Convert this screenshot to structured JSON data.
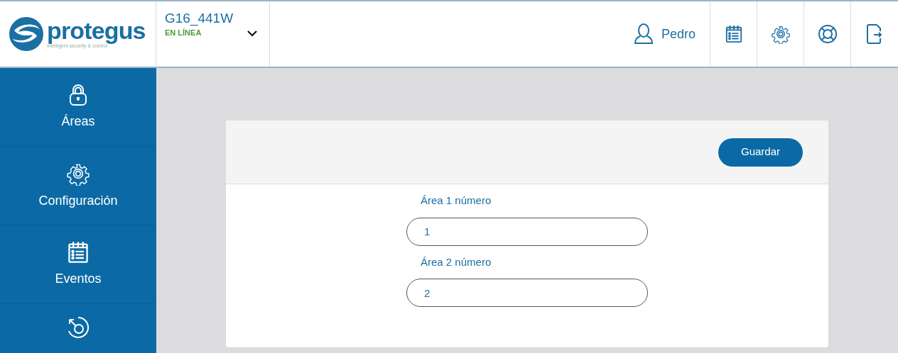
{
  "logo": {
    "name": "protegus",
    "tagline": "intelligent security & control"
  },
  "device": {
    "name": "G16_441W",
    "status": "EN LÍNEA",
    "online": true
  },
  "user": {
    "name": "Pedro"
  },
  "sidebar": {
    "items": [
      {
        "kind": "lock",
        "label": "Áreas"
      },
      {
        "kind": "gear",
        "label": "Configuración"
      },
      {
        "kind": "calendar",
        "label": "Eventos"
      },
      {
        "kind": "rotate"
      }
    ]
  },
  "form": {
    "save_button": "Guardar",
    "fields": [
      {
        "label": "Área 1 número",
        "value": "1"
      },
      {
        "label": "Área 2 número",
        "value": "2"
      }
    ]
  }
}
